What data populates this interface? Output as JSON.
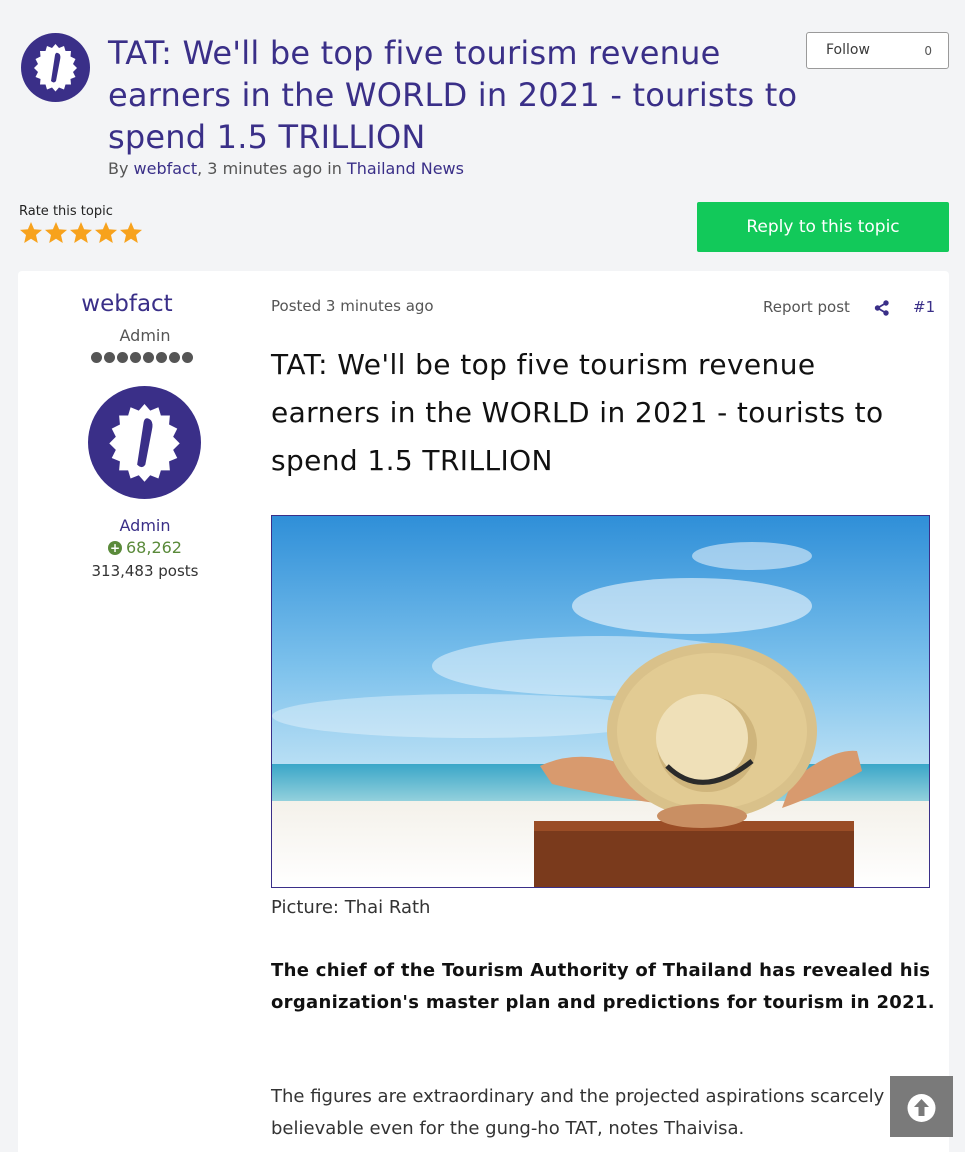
{
  "header": {
    "title": "TAT: We'll be top five tourism revenue earners in the WORLD in 2021 - tourists to spend 1.5 TRILLION",
    "byline_prefix": "By ",
    "author": "webfact",
    "byline_middle": ", 3 minutes ago in ",
    "forum": "Thailand News",
    "follow_label": "Follow",
    "follow_count": "0"
  },
  "rating": {
    "label": "Rate this topic",
    "stars": 5,
    "star_color": "#f7a21d"
  },
  "reply_button": "Reply to this topic",
  "author_panel": {
    "name": "webfact",
    "title": "Admin",
    "rank_pips": 8,
    "group": "Admin",
    "reputation": "68,262",
    "posts": "313,483 posts"
  },
  "post": {
    "posted": "Posted 3 minutes ago",
    "report": "Report post",
    "number": "#1",
    "heading": "TAT: We'll be top five tourism revenue earners in the WORLD in 2021 - tourists to spend 1.5 TRILLION",
    "caption": "Picture: Thai Rath",
    "paragraph1": "The chief of the Tourism Authority of Thailand has revealed his organization's master plan and predictions for tourism in 2021.",
    "paragraph2": "The figures are extraordinary and the projected aspirations scarcely believable even for the gung-ho TAT, notes Thaivisa."
  },
  "colors": {
    "brand": "#3a2f88",
    "reply_green": "#12c95a",
    "reputation_green": "#5a8a3a"
  }
}
